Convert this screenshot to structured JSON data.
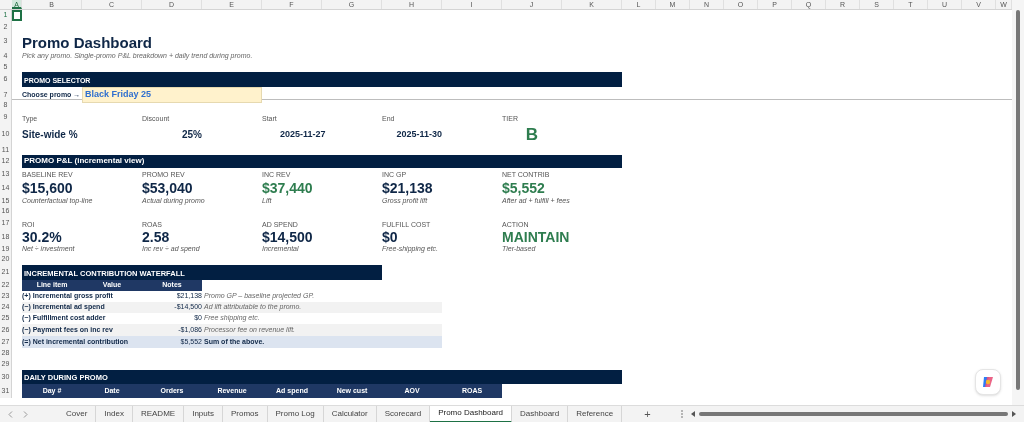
{
  "columns": [
    {
      "label": "A",
      "selected": true
    },
    {
      "label": "B",
      "selected": false
    },
    {
      "label": "C",
      "selected": false
    },
    {
      "label": "D",
      "selected": false
    },
    {
      "label": "E",
      "selected": false
    },
    {
      "label": "F",
      "selected": false
    },
    {
      "label": "G",
      "selected": false
    },
    {
      "label": "H",
      "selected": false
    },
    {
      "label": "I",
      "selected": false
    },
    {
      "label": "J",
      "selected": false
    },
    {
      "label": "K",
      "selected": false
    },
    {
      "label": "L",
      "selected": false
    },
    {
      "label": "M",
      "selected": false
    },
    {
      "label": "N",
      "selected": false
    },
    {
      "label": "O",
      "selected": false
    },
    {
      "label": "P",
      "selected": false
    },
    {
      "label": "Q",
      "selected": false
    },
    {
      "label": "R",
      "selected": false
    },
    {
      "label": "S",
      "selected": false
    },
    {
      "label": "T",
      "selected": false
    },
    {
      "label": "U",
      "selected": false
    },
    {
      "label": "V",
      "selected": false
    },
    {
      "label": "W",
      "selected": false
    }
  ],
  "rows": [
    {
      "label": "1",
      "selected": true
    },
    {
      "label": "2",
      "selected": false
    },
    {
      "label": "3",
      "selected": false
    },
    {
      "label": "4",
      "selected": false
    },
    {
      "label": "5",
      "selected": false
    },
    {
      "label": "6",
      "selected": false
    },
    {
      "label": "7",
      "selected": false
    },
    {
      "label": "8",
      "selected": false
    },
    {
      "label": "9",
      "selected": false
    },
    {
      "label": "10",
      "selected": false
    },
    {
      "label": "11",
      "selected": false
    },
    {
      "label": "12",
      "selected": false
    },
    {
      "label": "13",
      "selected": false
    },
    {
      "label": "14",
      "selected": false
    },
    {
      "label": "15",
      "selected": false
    },
    {
      "label": "16",
      "selected": false
    },
    {
      "label": "17",
      "selected": false
    },
    {
      "label": "18",
      "selected": false
    },
    {
      "label": "19",
      "selected": false
    },
    {
      "label": "20",
      "selected": false
    },
    {
      "label": "21",
      "selected": false
    },
    {
      "label": "22",
      "selected": false
    },
    {
      "label": "23",
      "selected": false
    },
    {
      "label": "24",
      "selected": false
    },
    {
      "label": "25",
      "selected": false
    },
    {
      "label": "26",
      "selected": false
    },
    {
      "label": "27",
      "selected": false
    },
    {
      "label": "28",
      "selected": false
    },
    {
      "label": "29",
      "selected": false
    },
    {
      "label": "30",
      "selected": false
    },
    {
      "label": "31",
      "selected": false
    }
  ],
  "title": "Promo Dashboard",
  "subtitle": "Pick any promo. Single-promo P&L breakdown + daily trend during promo.",
  "selector": {
    "header": "PROMO SELECTOR",
    "label": "Choose promo →",
    "value": "Black Friday 25"
  },
  "summary": [
    {
      "label": "Type",
      "value": "Site-wide %",
      "color": "#0f2747"
    },
    {
      "label": "Discount",
      "value": "25%",
      "color": "#0f2747"
    },
    {
      "label": "Start",
      "value": "2025-11-27",
      "color": "#0f2747"
    },
    {
      "label": "End",
      "value": "2025-11-30",
      "color": "#0f2747"
    },
    {
      "label": "TIER",
      "value": "B",
      "color": "#2e7d4f"
    }
  ],
  "pnl": {
    "header": "PROMO P&L  (incremental view)",
    "kpis": [
      {
        "label": "BASELINE REV",
        "value": "$15,600",
        "caption": "Counterfactual top-line",
        "color": "#0f2747"
      },
      {
        "label": "PROMO REV",
        "value": "$53,040",
        "caption": "Actual during promo",
        "color": "#0f2747"
      },
      {
        "label": "INC REV",
        "value": "$37,440",
        "caption": "Lift",
        "color": "#2e7d4f"
      },
      {
        "label": "INC GP",
        "value": "$21,138",
        "caption": "Gross profit lift",
        "color": "#0f2747"
      },
      {
        "label": "NET CONTRIB",
        "value": "$5,552",
        "caption": "After ad + fulfill + fees",
        "color": "#2e7d4f"
      },
      {
        "label": "ROI",
        "value": "30.2%",
        "caption": "Net ÷ investment",
        "color": "#0f2747"
      },
      {
        "label": "ROAS",
        "value": "2.58",
        "caption": "Inc rev ÷ ad spend",
        "color": "#0f2747"
      },
      {
        "label": "AD SPEND",
        "value": "$14,500",
        "caption": "Incremental",
        "color": "#0f2747"
      },
      {
        "label": "FULFILL COST",
        "value": "$0",
        "caption": "Free-shipping etc.",
        "color": "#0f2747"
      },
      {
        "label": "ACTION",
        "value": "MAINTAIN",
        "caption": "Tier-based",
        "color": "#2e7d4f"
      }
    ]
  },
  "waterfall": {
    "header": "INCREMENTAL CONTRIBUTION WATERFALL",
    "columns": [
      "Line item",
      "Value",
      "Notes"
    ],
    "rows": [
      {
        "line_item": "(+) Incremental gross profit",
        "value": "$21,138",
        "notes": "Promo GP – baseline projected GP.",
        "kind": "term"
      },
      {
        "line_item": "(−) Incremental ad spend",
        "value": "-$14,500",
        "notes": "Ad lift attributable to the promo.",
        "kind": "term"
      },
      {
        "line_item": "(−) Fulfillment cost adder",
        "value": "$0",
        "notes": "Free shipping etc.",
        "kind": "term"
      },
      {
        "line_item": "(−) Payment fees on inc rev",
        "value": "-$1,086",
        "notes": "Processor fee on revenue lift.",
        "kind": "term"
      },
      {
        "line_item": "(=) Net incremental contribution",
        "value": "$5,552",
        "notes": "Sum of the above.",
        "kind": "total"
      }
    ]
  },
  "daily": {
    "header": "DAILY DURING PROMO",
    "columns": [
      "Day #",
      "Date",
      "Orders",
      "Revenue",
      "Ad spend",
      "New cust",
      "AOV",
      "ROAS"
    ]
  },
  "sheet_tabs": [
    {
      "label": "Cover",
      "selected": false
    },
    {
      "label": "Index",
      "selected": false
    },
    {
      "label": "README",
      "selected": false
    },
    {
      "label": "Inputs",
      "selected": false
    },
    {
      "label": "Promos",
      "selected": false
    },
    {
      "label": "Promo Log",
      "selected": false
    },
    {
      "label": "Calculator",
      "selected": false
    },
    {
      "label": "Scorecard",
      "selected": false
    },
    {
      "label": "Promo Dashboard",
      "selected": true
    },
    {
      "label": "Dashboard",
      "selected": false
    },
    {
      "label": "Reference",
      "selected": false
    }
  ],
  "add_sheet": "+"
}
